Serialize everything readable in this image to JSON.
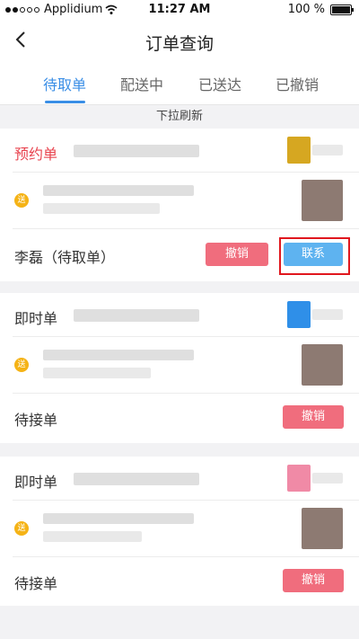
{
  "status_bar": {
    "carrier": "Applidium",
    "time": "11:27 AM",
    "battery": "100 %"
  },
  "nav": {
    "title": "订单查询"
  },
  "tabs": [
    {
      "label": "待取单",
      "active": true
    },
    {
      "label": "配送中",
      "active": false
    },
    {
      "label": "已送达",
      "active": false
    },
    {
      "label": "已撤销",
      "active": false
    }
  ],
  "refresh_hint": "下拉刷新",
  "orders": [
    {
      "type": "预约单",
      "send_badge": "送",
      "status": "李磊（待取单）",
      "cancel_label": "撤销",
      "contact_label": "联系"
    },
    {
      "type": "即时单",
      "send_badge": "送",
      "status": "待接单",
      "cancel_label": "撤销"
    },
    {
      "type": "即时单",
      "send_badge": "送",
      "status": "待接单",
      "cancel_label": "撤销"
    }
  ],
  "colors": {
    "accent": "#3a8ee6",
    "cancel": "#f06d7d",
    "contact": "#5eb3f0",
    "reservation": "#e8434e"
  }
}
